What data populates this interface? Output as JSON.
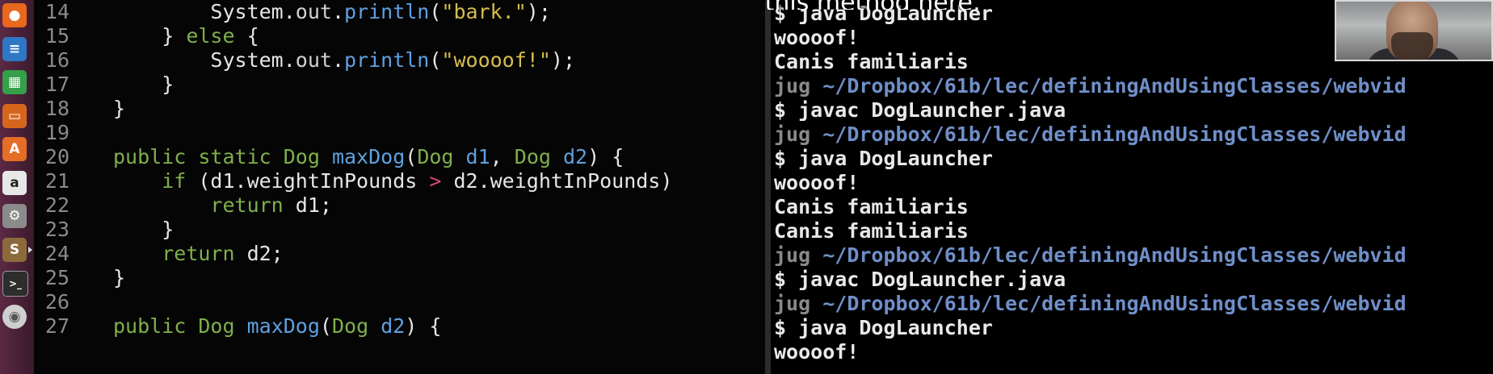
{
  "caption": "this method here,",
  "launcher": {
    "icons": [
      {
        "name": "firefox-icon",
        "glyph": "●",
        "color": "#e8681d"
      },
      {
        "name": "writer-icon",
        "glyph": "≡",
        "color": "#2f77c4"
      },
      {
        "name": "calc-icon",
        "glyph": "▦",
        "color": "#35a049"
      },
      {
        "name": "impress-icon",
        "glyph": "▭",
        "color": "#d6661e"
      },
      {
        "name": "software-center-icon",
        "glyph": "A",
        "color": "#e56d25"
      },
      {
        "name": "amazon-icon",
        "glyph": "a",
        "color": "#e8e8e8"
      },
      {
        "name": "system-settings-icon",
        "glyph": "⚙",
        "color": "#8b8b8b"
      },
      {
        "name": "sublime-text-icon",
        "glyph": "S",
        "color": "#8c6a3c"
      },
      {
        "name": "terminal-icon",
        "glyph": ">_",
        "color": "#2d2d2d"
      },
      {
        "name": "dvd-icon",
        "glyph": "◉",
        "color": "#cfcfcf"
      }
    ]
  },
  "editor": {
    "line_numbers": [
      "14",
      "15",
      "16",
      "17",
      "18",
      "19",
      "20",
      "21",
      "22",
      "23",
      "24",
      "25",
      "26",
      "27"
    ]
  },
  "terminal": {
    "user": "jug",
    "path": "~/Dropbox/61b/lec/definingAndUsingClasses/webvid",
    "prompt_symbol": "$",
    "lines": [
      {
        "kind": "cmd",
        "text": "java DogLauncher"
      },
      {
        "kind": "out",
        "text": "woooof!"
      },
      {
        "kind": "out",
        "text": "Canis familiaris"
      },
      {
        "kind": "prompt"
      },
      {
        "kind": "cmd",
        "text": "javac DogLauncher.java"
      },
      {
        "kind": "prompt"
      },
      {
        "kind": "cmd",
        "text": "java DogLauncher"
      },
      {
        "kind": "out",
        "text": "woooof!"
      },
      {
        "kind": "out",
        "text": "Canis familiaris"
      },
      {
        "kind": "out",
        "text": "Canis familiaris"
      },
      {
        "kind": "prompt"
      },
      {
        "kind": "cmd",
        "text": "javac DogLauncher.java"
      },
      {
        "kind": "prompt"
      },
      {
        "kind": "cmd",
        "text": "java DogLauncher"
      },
      {
        "kind": "out",
        "text": "woooof!"
      }
    ]
  }
}
